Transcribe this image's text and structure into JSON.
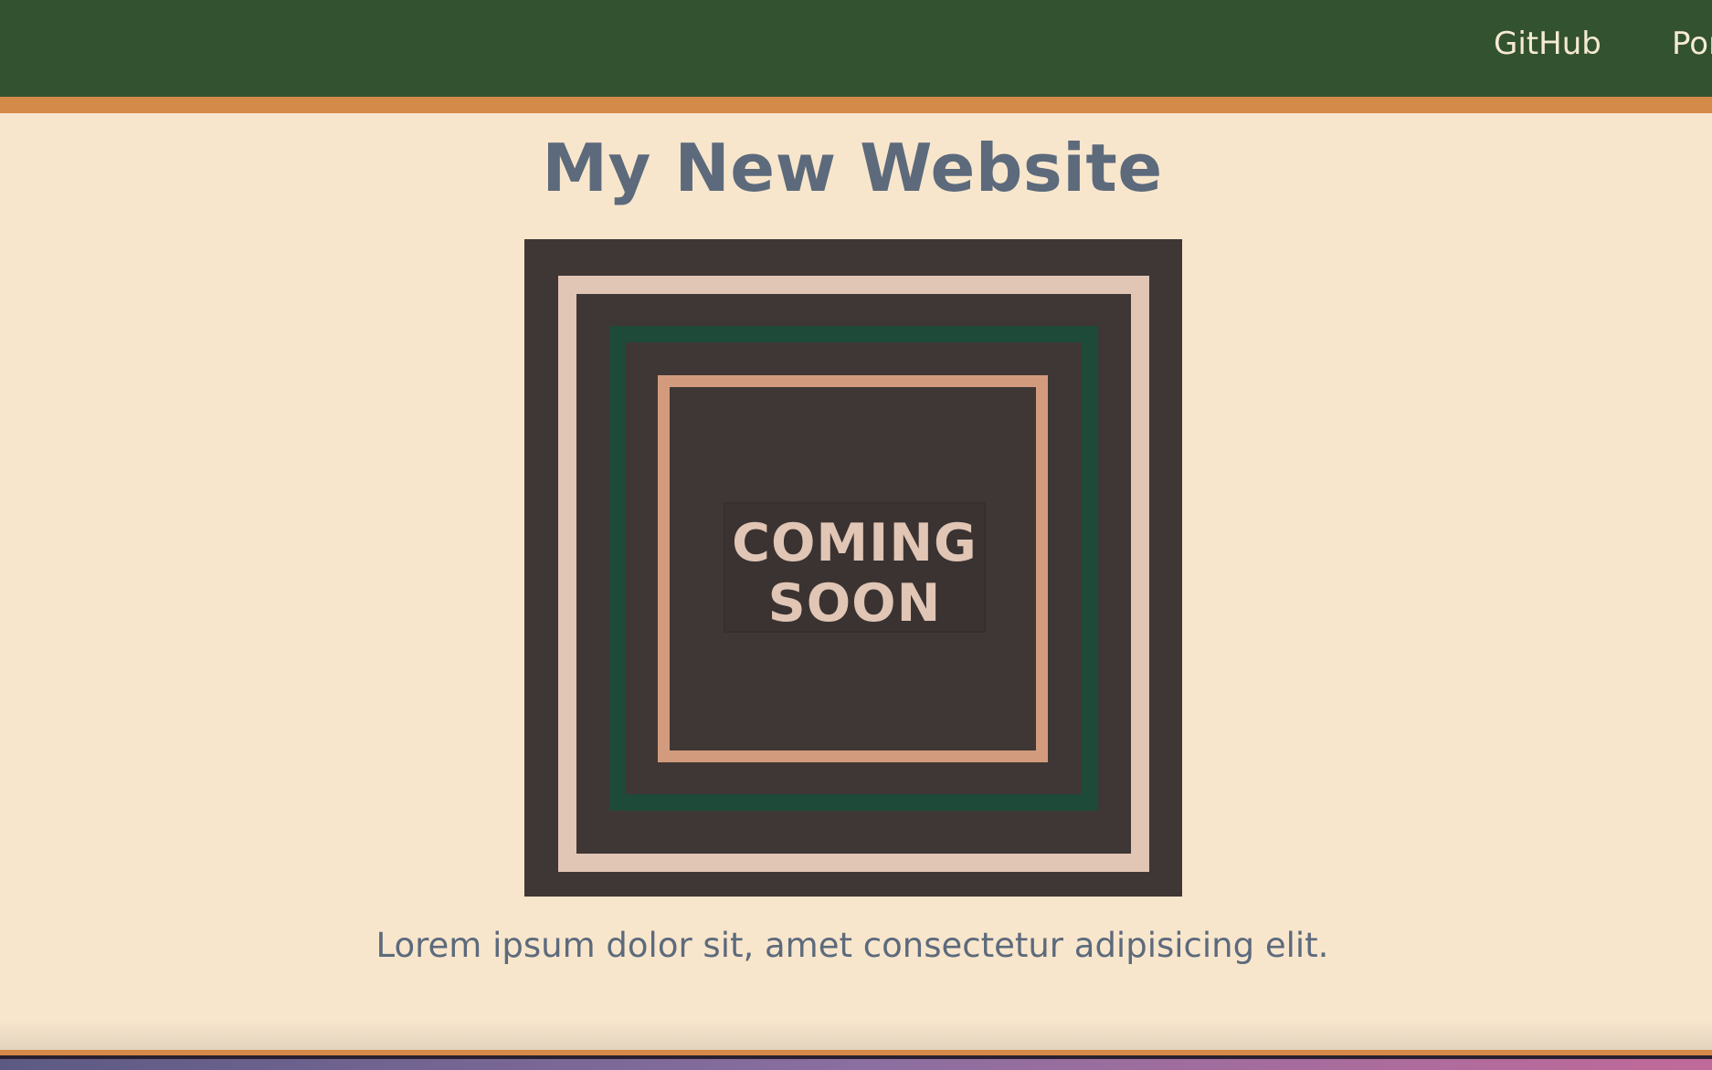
{
  "nav": {
    "links": [
      {
        "label": "GitHub"
      },
      {
        "label": "Por"
      }
    ]
  },
  "main": {
    "title": "My New Website",
    "hero_text": "COMING\nSOON",
    "lead": "Lorem ipsum dolor sit, amet consectetur adipisicing elit."
  },
  "colors": {
    "nav_bg": "#33522f",
    "accent": "#d48a49",
    "page_bg": "#f8e6cc",
    "text": "#5c6a7c",
    "hero_bg": "#3f3735",
    "hero_frame_light": "#e1c5b5",
    "hero_frame_green": "#1e4a3a",
    "hero_frame_peach": "#d39b7d"
  }
}
